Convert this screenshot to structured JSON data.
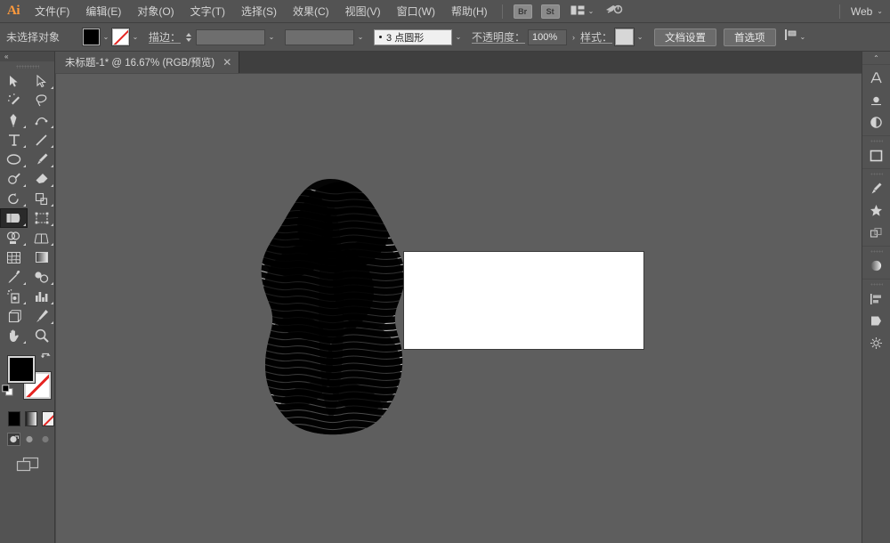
{
  "app": {
    "name": "Adobe Illustrator",
    "logo_text": "Ai",
    "bg_color": "#535353",
    "canvas_color": "#5e5e5e",
    "accent_color": "#ff9a3c"
  },
  "menubar": {
    "items": [
      {
        "label": "文件(F)",
        "name": "menu-file"
      },
      {
        "label": "编辑(E)",
        "name": "menu-edit"
      },
      {
        "label": "对象(O)",
        "name": "menu-object"
      },
      {
        "label": "文字(T)",
        "name": "menu-type"
      },
      {
        "label": "选择(S)",
        "name": "menu-select"
      },
      {
        "label": "效果(C)",
        "name": "menu-effect"
      },
      {
        "label": "视图(V)",
        "name": "menu-view"
      },
      {
        "label": "窗口(W)",
        "name": "menu-window"
      },
      {
        "label": "帮助(H)",
        "name": "menu-help"
      }
    ],
    "bridge_label": "Br",
    "stock_label": "St",
    "arrange_icon": "arrange-documents-icon",
    "search_icon": "search-adobe-stock-icon",
    "workspace": "Web",
    "workspace_chevron": "⌄"
  },
  "controlbar": {
    "selection_status": "未选择对象",
    "fill_label": "fill-swatch",
    "fill_color": "#000000",
    "stroke_label": "stroke-swatch",
    "stroke_value": "none",
    "stroke_weight_label": "描边：",
    "stroke_weight_value": "",
    "variable_width_value": "",
    "brush_definition": "3 点圆形",
    "opacity_label": "不透明度：",
    "opacity_value": "100%",
    "more_options": "›",
    "style_label": "样式：",
    "style_swatch_color": "#d7d7d7",
    "doc_setup_button": "文档设置",
    "preferences_button": "首选项",
    "align_icon": "align-to-artboard-icon"
  },
  "tabbar": {
    "tabs": [
      {
        "title": "未标题-1* @ 16.67% (RGB/预览)",
        "close": "✕",
        "active": true
      }
    ]
  },
  "toolbar": {
    "collapse_icon": "«",
    "grip": "panel-drag-grip",
    "tools": [
      {
        "name": "selection-tool",
        "icon": "arrow-solid",
        "has_flyout": false,
        "selected": false
      },
      {
        "name": "direct-selection-tool",
        "icon": "arrow-hollow",
        "has_flyout": true,
        "selected": false
      },
      {
        "name": "magic-wand-tool",
        "icon": "magic-wand",
        "has_flyout": false,
        "selected": false
      },
      {
        "name": "lasso-tool",
        "icon": "lasso",
        "has_flyout": false,
        "selected": false
      },
      {
        "name": "pen-tool",
        "icon": "pen",
        "has_flyout": true,
        "selected": false
      },
      {
        "name": "curvature-tool",
        "icon": "curvature",
        "has_flyout": false,
        "selected": false
      },
      {
        "name": "type-tool",
        "icon": "type-T",
        "has_flyout": true,
        "selected": false
      },
      {
        "name": "line-segment-tool",
        "icon": "line-segment",
        "has_flyout": true,
        "selected": false
      },
      {
        "name": "ellipse-tool",
        "icon": "ellipse",
        "has_flyout": true,
        "selected": false
      },
      {
        "name": "paintbrush-tool",
        "icon": "paintbrush",
        "has_flyout": true,
        "selected": false
      },
      {
        "name": "pencil-tool",
        "icon": "pencil-shaper",
        "has_flyout": true,
        "selected": false
      },
      {
        "name": "eraser-tool",
        "icon": "eraser",
        "has_flyout": true,
        "selected": false
      },
      {
        "name": "rotate-tool",
        "icon": "rotate",
        "has_flyout": true,
        "selected": false
      },
      {
        "name": "scale-tool",
        "icon": "scale",
        "has_flyout": true,
        "selected": false
      },
      {
        "name": "width-tool",
        "icon": "width-warp",
        "has_flyout": true,
        "selected": true
      },
      {
        "name": "free-transform-tool",
        "icon": "free-transform",
        "has_flyout": true,
        "selected": false
      },
      {
        "name": "shape-builder-tool",
        "icon": "shape-builder",
        "has_flyout": true,
        "selected": false
      },
      {
        "name": "perspective-grid-tool",
        "icon": "perspective-grid",
        "has_flyout": true,
        "selected": false
      },
      {
        "name": "mesh-tool",
        "icon": "mesh",
        "has_flyout": false,
        "selected": false
      },
      {
        "name": "gradient-tool",
        "icon": "gradient",
        "has_flyout": false,
        "selected": false
      },
      {
        "name": "eyedropper-tool",
        "icon": "eyedropper",
        "has_flyout": true,
        "selected": false
      },
      {
        "name": "blend-tool",
        "icon": "blend",
        "has_flyout": true,
        "selected": false
      },
      {
        "name": "symbol-sprayer-tool",
        "icon": "symbol-sprayer",
        "has_flyout": true,
        "selected": false
      },
      {
        "name": "column-graph-tool",
        "icon": "column-graph",
        "has_flyout": true,
        "selected": false
      },
      {
        "name": "artboard-tool",
        "icon": "artboard",
        "has_flyout": false,
        "selected": false
      },
      {
        "name": "slice-tool",
        "icon": "slice-knife",
        "has_flyout": true,
        "selected": false
      },
      {
        "name": "hand-tool",
        "icon": "hand",
        "has_flyout": true,
        "selected": false
      },
      {
        "name": "zoom-tool",
        "icon": "magnifier",
        "has_flyout": false,
        "selected": false
      }
    ],
    "fill_swatch_color": "#000000",
    "stroke_swatch_value": "none",
    "swap_icon": "swap-fill-stroke-icon",
    "default_icon": "default-fill-stroke-icon",
    "color_modes": [
      {
        "name": "color-mode-button",
        "kind": "solid"
      },
      {
        "name": "gradient-mode-button",
        "kind": "gradient"
      },
      {
        "name": "none-mode-button",
        "kind": "none"
      }
    ],
    "draw_modes": [
      {
        "name": "draw-normal-button",
        "selected": true
      },
      {
        "name": "draw-behind-button",
        "selected": false
      },
      {
        "name": "draw-inside-button",
        "selected": false
      }
    ],
    "screen_mode": "change-screen-mode-button"
  },
  "canvas": {
    "zoom_level": "16.67%",
    "artwork_name": "wave-line-torso-artwork",
    "artwork_description": "黑色波浪线条人体躯干图形",
    "white_rect_name": "white-rectangle-shape",
    "white_rect_fill": "#ffffff",
    "white_rect_stroke": "#3b3b3b"
  },
  "scrollbar": {
    "vertical_name": "canvas-vertical-scrollbar",
    "up_arrow": "⌃"
  },
  "dock": {
    "expand_icon": "⌃",
    "groups": [
      {
        "icons": [
          {
            "name": "character-panel-icon",
            "glyph": "A"
          },
          {
            "name": "paragraph-panel-icon",
            "glyph": "¶"
          },
          {
            "name": "appearance-panel-icon",
            "glyph": "◐"
          }
        ]
      },
      {
        "icons": [
          {
            "name": "artboards-panel-icon",
            "glyph": "▭"
          }
        ]
      },
      {
        "icons": [
          {
            "name": "brushes-panel-icon",
            "glyph": "brush"
          },
          {
            "name": "symbols-panel-icon",
            "glyph": "symbol"
          },
          {
            "name": "transform-panel-icon",
            "glyph": "transform"
          }
        ]
      },
      {
        "icons": [
          {
            "name": "gradient-panel-icon",
            "glyph": "gradient"
          }
        ]
      },
      {
        "icons": [
          {
            "name": "align-panel-icon",
            "glyph": "align"
          },
          {
            "name": "pathfinder-panel-icon",
            "glyph": "pathfinder"
          },
          {
            "name": "layers-panel-icon",
            "glyph": "layers"
          }
        ]
      }
    ]
  }
}
